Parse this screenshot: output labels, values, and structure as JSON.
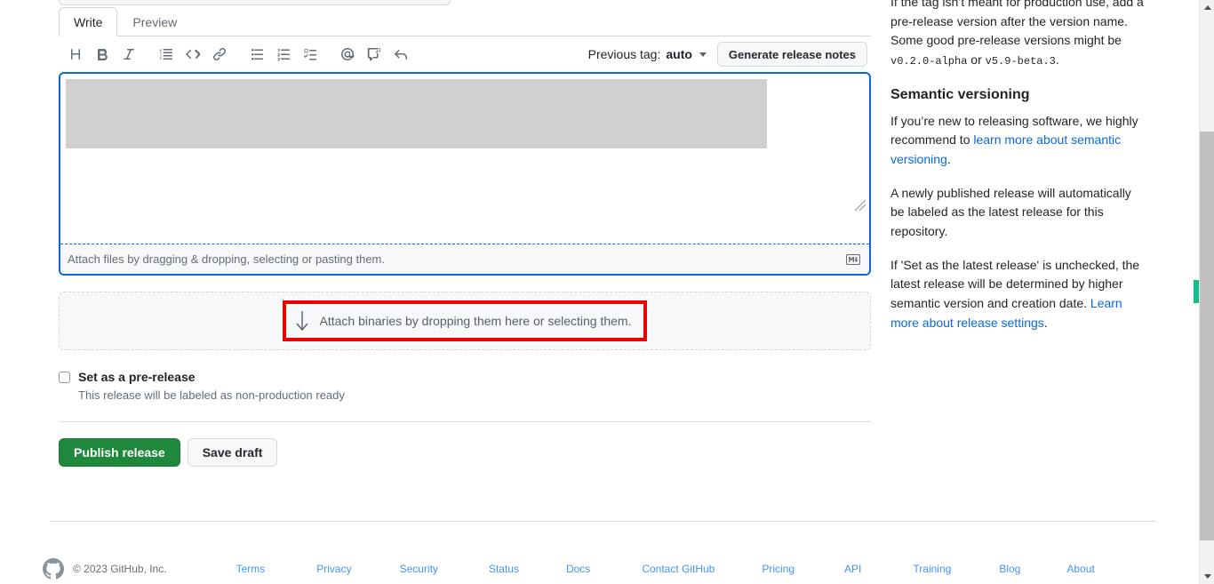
{
  "editor": {
    "tabs": [
      {
        "label": "Write",
        "active": true
      },
      {
        "label": "Preview",
        "active": false
      }
    ],
    "toolbar": {
      "icons": [
        "heading-icon",
        "bold-icon",
        "italic-icon",
        "quote-icon",
        "code-icon",
        "link-icon",
        "unordered-list-icon",
        "ordered-list-icon",
        "task-list-icon",
        "mention-icon",
        "reference-icon",
        "reply-icon"
      ],
      "previous_tag_label": "Previous tag:",
      "previous_tag_value": "auto",
      "generate_button": "Generate release notes"
    },
    "textarea": {
      "value": "",
      "placeholder": "",
      "attach_hint": "Attach files by dragging & dropping, selecting or pasting them.",
      "markdown_icon": "markdown-icon",
      "resize_handle": "resize-handle-icon"
    }
  },
  "dropzone": {
    "arrow_icon": "download-arrow-icon",
    "text": "Attach binaries by dropping them here or selecting them.",
    "highlight_color": "#ee0000"
  },
  "prerelease": {
    "checked": false,
    "label": "Set as a pre-release",
    "description": "This release will be labeled as non-production ready"
  },
  "actions": {
    "publish_label": "Publish release",
    "publish_color": "#1f883d",
    "save_draft_label": "Save draft"
  },
  "sidebar": {
    "paragraph_1_part_1": "If the tag isn’t meant for production use, add a pre-release version after the version name. Some good pre-release versions might be ",
    "paragraph_1_code_1": "v0.2.0-alpha",
    "paragraph_1_part_2": " or ",
    "paragraph_1_code_2": "v5.9-beta.3",
    "paragraph_1_part_3": ".",
    "heading": "Semantic versioning",
    "paragraph_2_part_1": "If you’re new to releasing software, we highly recommend to ",
    "paragraph_2_link": "learn more about semantic versioning",
    "paragraph_2_part_2": ".",
    "paragraph_3": "A newly published release will automatically be labeled as the latest release for this repository.",
    "paragraph_4_part_1": "If 'Set as the latest release' is unchecked, the latest release will be determined by higher semantic version and creation date. ",
    "paragraph_4_link": "Learn more about release settings",
    "paragraph_4_part_2": "."
  },
  "footer": {
    "logo_icon": "github-mark-icon",
    "copyright": "© 2023 GitHub, Inc.",
    "links": [
      "Terms",
      "Privacy",
      "Security",
      "Status",
      "Docs",
      "Contact GitHub",
      "Pricing",
      "API",
      "Training",
      "Blog",
      "About"
    ]
  },
  "scrollbar": {
    "up_arrow_icon": "scroll-up-arrow-icon",
    "down_arrow_icon": "scroll-down-arrow-icon",
    "marker_color": "#0fc08e"
  }
}
